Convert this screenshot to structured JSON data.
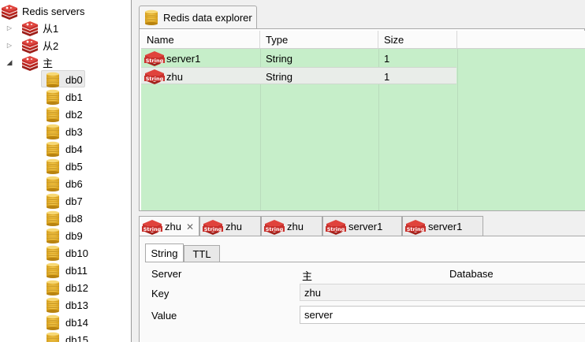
{
  "tree": {
    "root_label": "Redis servers",
    "servers": [
      {
        "label": "从1",
        "expanded": false
      },
      {
        "label": "从2",
        "expanded": false
      },
      {
        "label": "主",
        "expanded": true
      }
    ],
    "databases": [
      "db0",
      "db1",
      "db2",
      "db3",
      "db4",
      "db5",
      "db6",
      "db7",
      "db8",
      "db9",
      "db10",
      "db11",
      "db12",
      "db13",
      "db14",
      "db15"
    ],
    "selected_database": "db0"
  },
  "explorer": {
    "tab_label": "Redis data explorer",
    "columns": [
      "Name",
      "Type",
      "Size"
    ],
    "rows": [
      {
        "icon_text": "String",
        "name": "server1",
        "type": "String",
        "size": "1"
      },
      {
        "icon_text": "String",
        "name": "zhu",
        "type": "String",
        "size": "1"
      }
    ]
  },
  "editor_tabs": [
    {
      "label": "zhu",
      "active": true,
      "closable": true
    },
    {
      "label": "zhu",
      "active": false
    },
    {
      "label": "zhu",
      "active": false
    },
    {
      "label": "server1",
      "active": false
    },
    {
      "label": "server1",
      "active": false
    }
  ],
  "detail": {
    "subtabs": [
      "String",
      "TTL"
    ],
    "server_label": "Server",
    "server_value": "主",
    "database_label": "Database",
    "key_label": "Key",
    "key_value": "zhu",
    "value_label": "Value",
    "value_value": "server"
  },
  "colors": {
    "table_bg": "#c6eec9",
    "redis_red": "#c9302c",
    "db_gold": "#d9a21f"
  }
}
